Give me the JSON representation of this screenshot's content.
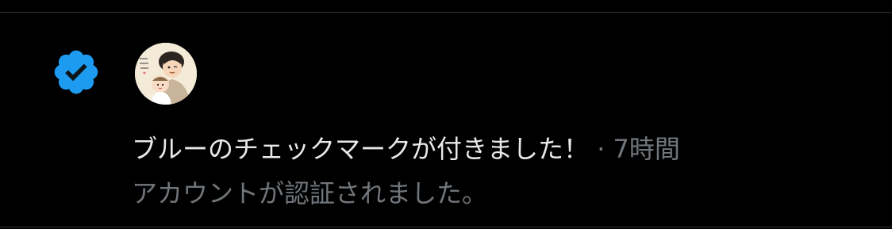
{
  "notification": {
    "message": "ブルーのチェックマークが付きました！",
    "separator": "·",
    "time": "7時間",
    "subtext": "アカウントが認証されました。"
  },
  "icons": {
    "verified": "verified-badge-icon",
    "avatar": "user-avatar"
  },
  "colors": {
    "background": "#000000",
    "verified_blue": "#1d9bf0",
    "primary_text": "#e7e9ea",
    "secondary_text": "#71767b",
    "divider": "#2f3336"
  }
}
